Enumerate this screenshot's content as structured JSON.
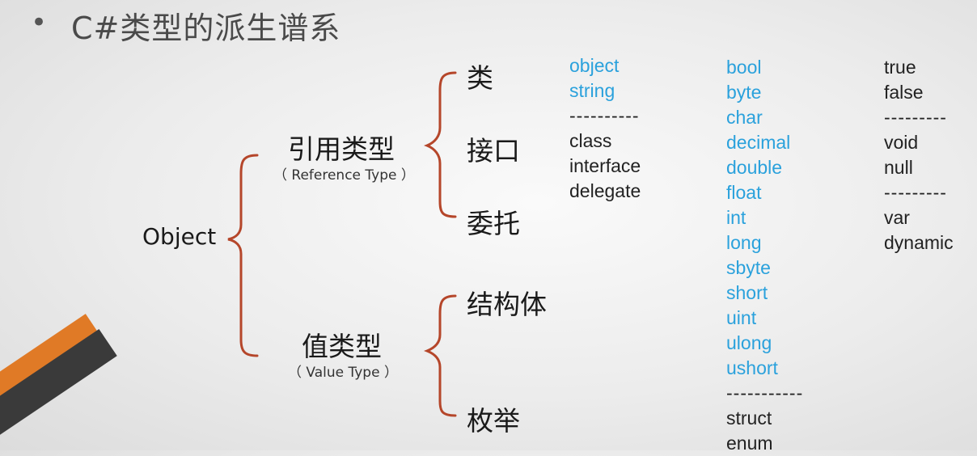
{
  "title": {
    "bullet": "•",
    "text": "C#类型的派生谱系"
  },
  "tree": {
    "root": "Object",
    "reference": {
      "label": "引用类型",
      "english": "（ Reference Type ）",
      "children": [
        "类",
        "接口",
        "委托"
      ]
    },
    "value": {
      "label": "值类型",
      "english": "（ Value Type ）",
      "children": [
        "结构体",
        "枚举"
      ]
    }
  },
  "columns": {
    "col1": {
      "builtin": [
        "object",
        "string"
      ],
      "separator": "----------",
      "keywords": [
        "class",
        "interface",
        "delegate"
      ]
    },
    "col2": {
      "builtin": [
        "bool",
        "byte",
        "char",
        "decimal",
        "double",
        "float",
        "int",
        "long",
        "sbyte",
        "short",
        "uint",
        "ulong",
        "ushort"
      ],
      "separator": "-----------",
      "keywords": [
        "struct",
        "enum"
      ]
    },
    "col3": {
      "group1": [
        "true",
        "false"
      ],
      "separator1": "---------",
      "group2": [
        "void",
        "null"
      ],
      "separator2": "---------",
      "group3": [
        "var",
        "dynamic"
      ]
    }
  },
  "colors": {
    "brace": "#b5462a",
    "builtin_blue": "#2aa1dc",
    "accent_orange": "#e07a26"
  }
}
